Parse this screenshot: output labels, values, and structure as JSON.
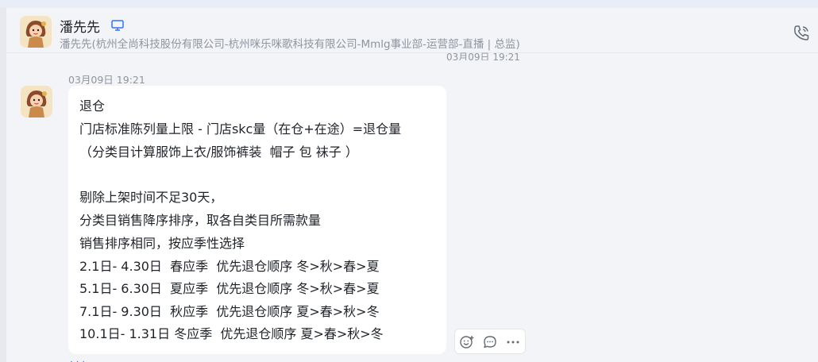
{
  "header": {
    "contact_name": "潘先先",
    "contact_subtitle": "潘先先(杭州全尚科技股份有限公司-杭州咪乐咪歌科技有限公司-Mmlg事业部-运营部-直播 | 总监)",
    "device_icon": "desktop-icon",
    "call_icon": "phone-call-icon"
  },
  "timeline": {
    "previous_timestamp": "03月09日 19:21"
  },
  "message": {
    "timestamp": "03月09日 19:21",
    "lines": [
      "退仓",
      "门店标准陈列量上限 - 门店skc量（在仓+在途）=退仓量",
      "（分类目计算服饰上衣/服饰裤装  帽子 包 袜子 ）",
      "",
      "剔除上架时间不足30天，",
      "分类目销售降序排序，取各自类目所需款量",
      "销售排序相同，按应季性选择",
      "2.1日- 4.30日  春应季  优先退仓顺序 冬>秋>春>夏",
      "5.1日- 6.30日  夏应季  优先退仓顺序 冬>秋>春>夏",
      "7.1日- 9.30日  秋应季  优先退仓顺序 夏>春>秋>冬",
      "10.1日- 1.31日 冬应季  优先退仓顺序 夏>春>秋>冬"
    ]
  },
  "message_actions": {
    "icons": [
      "emoji-reaction-icon",
      "reply-icon",
      "more-icon"
    ]
  },
  "colors": {
    "background": "#f3f4f7",
    "bubble": "#ffffff",
    "secondary_text": "#8f959e",
    "accent": "#3370ff"
  }
}
